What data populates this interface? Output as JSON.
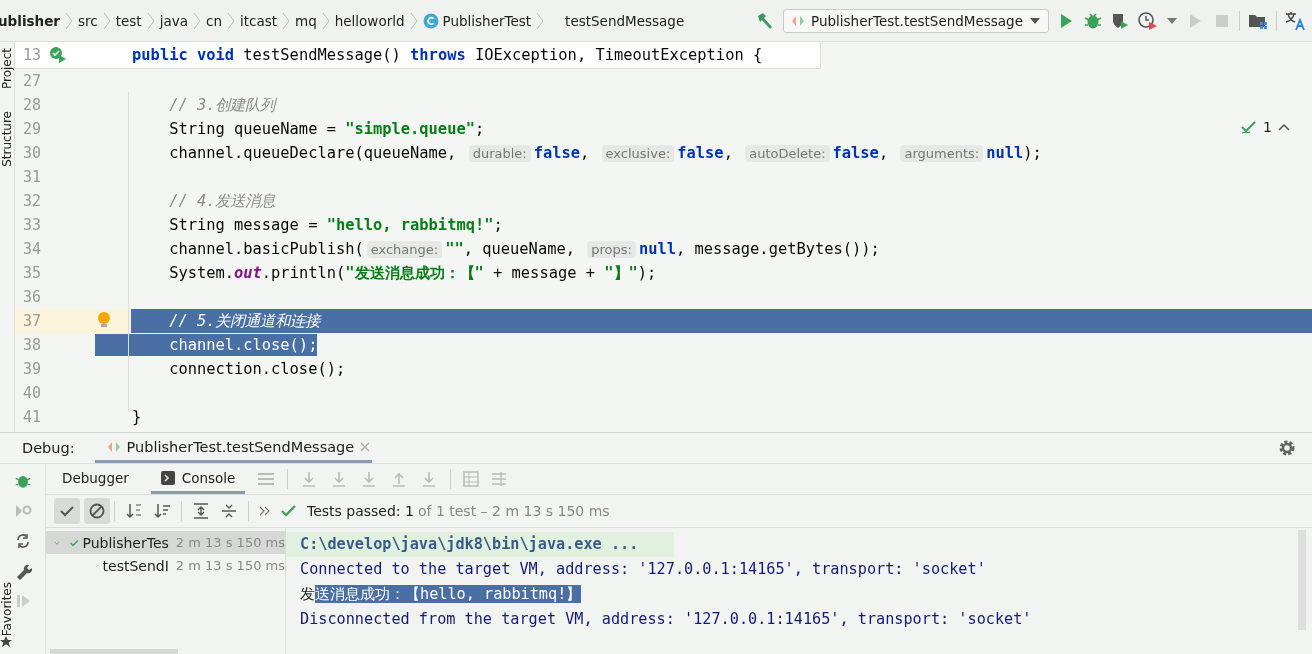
{
  "breadcrumbs": [
    {
      "label": "ublisher",
      "kind": "module"
    },
    {
      "label": "src",
      "kind": "folder"
    },
    {
      "label": "test",
      "kind": "folder"
    },
    {
      "label": "java",
      "kind": "folder"
    },
    {
      "label": "cn",
      "kind": "folder"
    },
    {
      "label": "itcast",
      "kind": "folder"
    },
    {
      "label": "mq",
      "kind": "folder"
    },
    {
      "label": "helloworld",
      "kind": "folder"
    },
    {
      "label": "PublisherTest",
      "kind": "class"
    },
    {
      "label": "testSendMessage",
      "kind": "method"
    }
  ],
  "run_config": {
    "label": "PublisherTest.testSendMessage"
  },
  "side_tools": [
    {
      "label": "Project"
    },
    {
      "label": "Structure"
    }
  ],
  "sticky_line": {
    "number": "13",
    "tokens": [
      {
        "kind": "keyword",
        "text": "    public void "
      },
      {
        "kind": "plain",
        "text": "testSendMessage() "
      },
      {
        "kind": "keyword",
        "text": "throws "
      },
      {
        "kind": "plain",
        "text": "IOException, TimeoutException {"
      }
    ]
  },
  "inspection": {
    "count": "1"
  },
  "lines": [
    {
      "number": "27",
      "selected": false,
      "caret": false
    },
    {
      "number": "28",
      "tokens": [
        {
          "kind": "comment",
          "text": "        // 3.创建队列"
        }
      ],
      "selected": false,
      "caret": false
    },
    {
      "number": "29",
      "tokens": [
        {
          "kind": "plain",
          "text": "        String queueName = "
        },
        {
          "kind": "string",
          "text": "\"simple.queue\""
        },
        {
          "kind": "plain",
          "text": ";"
        }
      ],
      "selected": false,
      "caret": false
    },
    {
      "number": "30",
      "tokens": [
        {
          "kind": "plain",
          "text": "        channel.queueDeclare(queueName, "
        },
        {
          "kind": "hint",
          "text": "durable:"
        },
        {
          "kind": "keyword",
          "text": "false"
        },
        {
          "kind": "plain",
          "text": ", "
        },
        {
          "kind": "hint",
          "text": "exclusive:"
        },
        {
          "kind": "keyword",
          "text": "false"
        },
        {
          "kind": "plain",
          "text": ", "
        },
        {
          "kind": "hint",
          "text": "autoDelete:"
        },
        {
          "kind": "keyword",
          "text": "false"
        },
        {
          "kind": "plain",
          "text": ", "
        },
        {
          "kind": "hint",
          "text": "arguments:"
        },
        {
          "kind": "keyword",
          "text": "null"
        },
        {
          "kind": "plain",
          "text": ");"
        }
      ],
      "selected": false,
      "caret": false
    },
    {
      "number": "31",
      "selected": false,
      "caret": false
    },
    {
      "number": "32",
      "tokens": [
        {
          "kind": "comment",
          "text": "        // 4.发送消息"
        }
      ],
      "selected": false,
      "caret": false
    },
    {
      "number": "33",
      "tokens": [
        {
          "kind": "plain",
          "text": "        String message = "
        },
        {
          "kind": "string",
          "text": "\"hello, rabbitmq!\""
        },
        {
          "kind": "plain",
          "text": ";"
        }
      ],
      "selected": false,
      "caret": false
    },
    {
      "number": "34",
      "tokens": [
        {
          "kind": "plain",
          "text": "        channel.basicPublish("
        },
        {
          "kind": "hint",
          "text": "exchange:"
        },
        {
          "kind": "string",
          "text": "\"\""
        },
        {
          "kind": "plain",
          "text": ", queueName, "
        },
        {
          "kind": "hint",
          "text": "props:"
        },
        {
          "kind": "keyword",
          "text": "null"
        },
        {
          "kind": "plain",
          "text": ", message.getBytes());"
        }
      ],
      "selected": false,
      "caret": false
    },
    {
      "number": "35",
      "tokens": [
        {
          "kind": "plain",
          "text": "        System."
        },
        {
          "kind": "static",
          "text": "out"
        },
        {
          "kind": "plain",
          "text": ".println("
        },
        {
          "kind": "string",
          "text": "\"发送消息成功：【\""
        },
        {
          "kind": "plain",
          "text": " + message + "
        },
        {
          "kind": "string",
          "text": "\"】\""
        },
        {
          "kind": "plain",
          "text": ");"
        }
      ],
      "selected": false,
      "caret": false
    },
    {
      "number": "36",
      "selected": false,
      "caret": false
    },
    {
      "number": "37",
      "tokens": [
        {
          "kind": "comment",
          "text": "        // 5.关闭通道和连接"
        }
      ],
      "selected": true,
      "to_line_end": true,
      "caret": true
    },
    {
      "number": "38",
      "tokens": [
        {
          "kind": "plain",
          "text": "        channel.close();"
        }
      ],
      "selected": true,
      "to_line_end": false,
      "caret": false
    },
    {
      "number": "39",
      "tokens": [
        {
          "kind": "plain",
          "text": "        connection.close();"
        }
      ],
      "selected": false,
      "caret": false
    },
    {
      "number": "40",
      "selected": false,
      "caret": false
    },
    {
      "number": "41",
      "tokens": [
        {
          "kind": "plain",
          "text": "    }"
        }
      ],
      "selected": false,
      "caret": false
    }
  ],
  "debug": {
    "label": "Debug:",
    "tab": "PublisherTest.testSendMessage",
    "subtabs": [
      {
        "label": "Debugger",
        "selected": false
      },
      {
        "label": "Console",
        "selected": true
      }
    ],
    "toggles": [
      {
        "kind": "check",
        "on": true
      },
      {
        "kind": "ban",
        "on": true
      }
    ],
    "status": "Tests passed: 1",
    "status_detail": "of 1 test – 2 m 13 s 150 ms",
    "tree": [
      {
        "name": "PublisherTes",
        "time": "2 m 13 s 150 ms",
        "selected": true,
        "expanded": true,
        "children": [
          {
            "name": "testSendI",
            "time": "2 m 13 s 150 ms",
            "selected": false
          }
        ]
      }
    ],
    "console": [
      {
        "kind": "command",
        "segments": [
          {
            "text": "C:\\develop\\java\\jdk8\\bin\\java.exe ...",
            "selected": false
          }
        ]
      },
      {
        "kind": "info",
        "segments": [
          {
            "text": "Connected to the target VM, address: '127.0.0.1:14165', transport: 'socket'",
            "selected": false
          }
        ]
      },
      {
        "kind": "output",
        "segments": [
          {
            "text": "发",
            "selected": false
          },
          {
            "text": "送消息成功：【hello, rabbitmq!】",
            "selected": true
          }
        ]
      },
      {
        "kind": "info",
        "segments": [
          {
            "text": "Disconnected from the target VM, address: '127.0.0.1:14165', transport: 'socket'",
            "selected": false
          }
        ]
      }
    ]
  },
  "favorites": {
    "label": "Favorites"
  }
}
